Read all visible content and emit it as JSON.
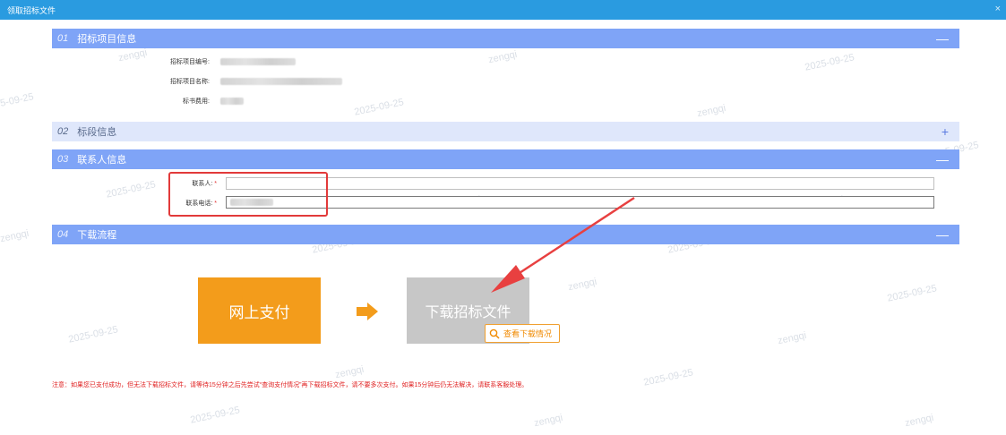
{
  "window": {
    "title": "领取招标文件",
    "close_glyph": "×"
  },
  "sections": [
    {
      "num": "01",
      "title": "招标项目信息",
      "toggle": "—"
    },
    {
      "num": "02",
      "title": "标段信息",
      "toggle": "+"
    },
    {
      "num": "03",
      "title": "联系人信息",
      "toggle": "—"
    },
    {
      "num": "04",
      "title": "下载流程",
      "toggle": "—"
    }
  ],
  "project_info": {
    "fields": [
      {
        "label": "招标项目编号:"
      },
      {
        "label": "招标项目名称:"
      },
      {
        "label": "标书费用:"
      }
    ]
  },
  "contact": {
    "name_label": "联系人:",
    "phone_label": "联系电话:",
    "required_mark": "*",
    "name_value": "",
    "phone_value": ""
  },
  "download": {
    "pay_label": "网上支付",
    "download_label": "下载招标文件",
    "check_label": "查看下载情况"
  },
  "notice": "注意：如果您已支付成功，但无法下载招标文件，请等待15分钟之后先尝试“查询支付情况”再下载招标文件，请不要多次支付。如果15分钟后仍无法解决，请联系客服处理。",
  "watermarks": {
    "date": "2025-09-25",
    "user": "zengqi",
    "date_partial": "5-09-25"
  },
  "colors": {
    "titlebar": "#2a9be0",
    "section_header": "#7fa4f7",
    "section_header_collapsed": "#dfe7fb",
    "pay_button": "#f39c1b",
    "download_button": "#c7c7c7",
    "highlight": "#e23a3a",
    "notice_text": "#e02020"
  },
  "icons": {
    "close": "close-icon",
    "arrow": "arrow-right-icon",
    "search": "search-icon",
    "annotation": "annotation-arrow-icon"
  }
}
